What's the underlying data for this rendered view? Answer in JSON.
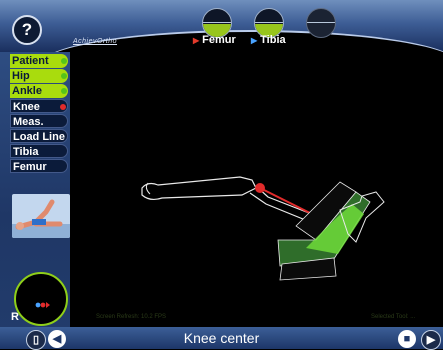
{
  "header": {
    "help_label": "?",
    "brand": "AchievOrtho",
    "bones": [
      {
        "label": "Femur",
        "marker_color": "#e33a2b"
      },
      {
        "label": "Tibia",
        "marker_color": "#4aa3ff"
      }
    ]
  },
  "sidebar": {
    "items": [
      {
        "label": "Patient",
        "style": "green",
        "dot": "green"
      },
      {
        "label": "Hip",
        "style": "green",
        "dot": "green"
      },
      {
        "label": "Ankle",
        "style": "green",
        "dot": "green"
      },
      {
        "label": "Knee",
        "style": "dark",
        "dot": "red"
      },
      {
        "label": "Meas.",
        "style": "dark",
        "dot": ""
      },
      {
        "label": "Load Line",
        "style": "dark",
        "dot": ""
      },
      {
        "label": "Tibia",
        "style": "dark",
        "dot": ""
      },
      {
        "label": "Femur",
        "style": "dark",
        "dot": ""
      }
    ],
    "radar_label": "R"
  },
  "status": {
    "left": "Screen Refresh: 10.2 FPS",
    "right": "Selected Tool: ..."
  },
  "bottom": {
    "title": "Knee center"
  },
  "colors": {
    "accent_green": "#a9dc0d",
    "highlight_red": "#e22b2b",
    "header_blue": "#3d5d95"
  }
}
